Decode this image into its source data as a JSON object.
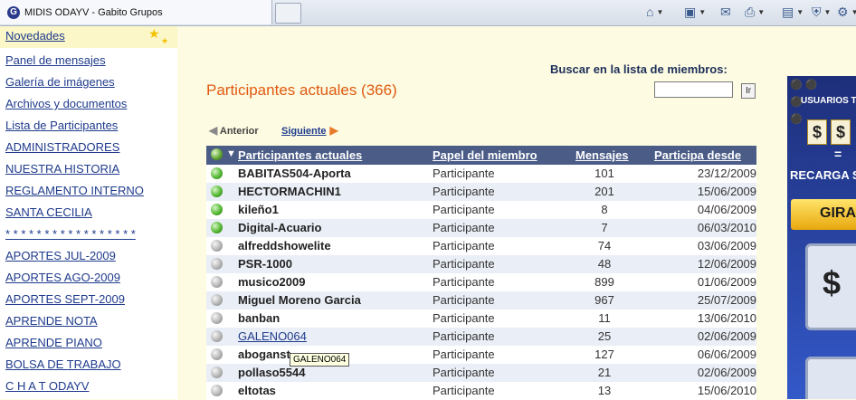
{
  "browser": {
    "tab_title": "MIDIS ODAYV - Gabito Grupos",
    "tab_logo": "G",
    "toolbar_icons": [
      "home-icon",
      "rss-icon",
      "mail-icon",
      "print-icon",
      "page-icon",
      "safety-icon",
      "tools-icon"
    ]
  },
  "sidebar": {
    "items": [
      {
        "label": "Novedades"
      },
      {
        "label": "Panel de mensajes"
      },
      {
        "label": "Galería de imágenes"
      },
      {
        "label": "Archivos y documentos"
      },
      {
        "label": "Lista de Participantes"
      },
      {
        "label": "ADMINISTRADORES"
      },
      {
        "label": "NUESTRA HISTORIA"
      },
      {
        "label": "REGLAMENTO INTERNO"
      },
      {
        "label": "SANTA CECILIA"
      },
      {
        "label": "* * * * * * * * * * * * * * * * *"
      },
      {
        "label": "APORTES JUL-2009"
      },
      {
        "label": "APORTES AGO-2009"
      },
      {
        "label": "APORTES SEPT-2009"
      },
      {
        "label": "APRENDE NOTA"
      },
      {
        "label": "APRENDE PIANO"
      },
      {
        "label": "BOLSA DE TRABAJO"
      },
      {
        "label": "C H A T  ODAYV"
      }
    ]
  },
  "main": {
    "title": "Participantes actuales (366)",
    "search": {
      "label": "Buscar en la lista de miembros:",
      "value": "",
      "button": "Ir"
    },
    "pager": {
      "prev": "Anterior",
      "next": "Siguiente"
    },
    "table": {
      "headers": {
        "name": "Participantes actuales",
        "role": "Papel del miembro",
        "messages": "Mensajes",
        "since": "Participa desde"
      },
      "rows": [
        {
          "name": "BABITAS504-Aporta",
          "role": "Participante",
          "messages": "101",
          "since": "23/12/2009",
          "online": true
        },
        {
          "name": "HECTORMACHIN1",
          "role": "Participante",
          "messages": "201",
          "since": "15/06/2009",
          "online": true
        },
        {
          "name": "kileño1",
          "role": "Participante",
          "messages": "8",
          "since": "04/06/2009",
          "online": true
        },
        {
          "name": "Digital-Acuario",
          "role": "Participante",
          "messages": "7",
          "since": "06/03/2010",
          "online": true
        },
        {
          "name": "alfreddshowelite",
          "role": "Participante",
          "messages": "74",
          "since": "03/06/2009",
          "online": false
        },
        {
          "name": "PSR-1000",
          "role": "Participante",
          "messages": "48",
          "since": "12/06/2009",
          "online": false
        },
        {
          "name": "musico2009",
          "role": "Participante",
          "messages": "899",
          "since": "01/06/2009",
          "online": false
        },
        {
          "name": "Miguel Moreno Garcia",
          "role": "Participante",
          "messages": "967",
          "since": "25/07/2009",
          "online": false
        },
        {
          "name": "banban",
          "role": "Participante",
          "messages": "11",
          "since": "13/06/2010",
          "online": false
        },
        {
          "name": "GALENO064",
          "role": "Participante",
          "messages": "25",
          "since": "02/06/2009",
          "online": false
        },
        {
          "name": "aboganst",
          "role": "Participante",
          "messages": "127",
          "since": "06/06/2009",
          "online": false
        },
        {
          "name": "pollaso5544",
          "role": "Participante",
          "messages": "21",
          "since": "02/06/2009",
          "online": false
        },
        {
          "name": "eltotas",
          "role": "Participante",
          "messages": "13",
          "since": "15/06/2010",
          "online": false
        }
      ]
    },
    "tooltip": "GALENO064"
  },
  "ad": {
    "text1": "USUARIOS T",
    "text2": "RECARGA S",
    "eq": "=",
    "gira": "GIRA",
    "dollar": "$"
  }
}
